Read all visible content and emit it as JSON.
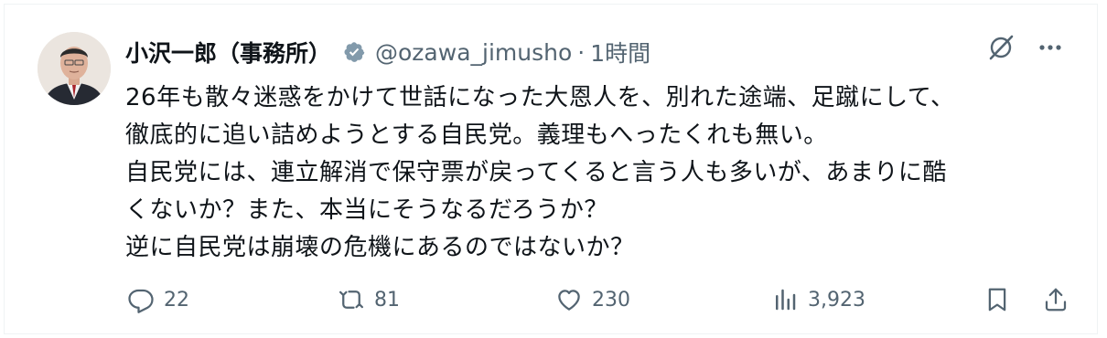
{
  "tweet": {
    "author_name": "小沢一郎（事務所）",
    "handle": "@ozawa_jimusho",
    "separator": "·",
    "time": "1時間",
    "verified_icon": "verified-badge-icon",
    "lines": [
      "26年も散々迷惑をかけて世話になった大恩人を、別れた途端、足蹴にして、",
      "徹底的に追い詰めようとする自民党。義理もへったくれも無い。",
      "自民党には、連立解消で保守票が戻ってくると言う人も多いが、あまりに酷",
      "くないか？また、本当にそうなるだろうか？",
      "逆に自民党は崩壊の危機にあるのではないか？"
    ]
  },
  "actions": {
    "reply_count": "22",
    "retweet_count": "81",
    "like_count": "230",
    "views_count": "3,923"
  },
  "colors": {
    "text": "#0f1419",
    "secondary": "#536471",
    "verified_badge": "#829aab"
  }
}
